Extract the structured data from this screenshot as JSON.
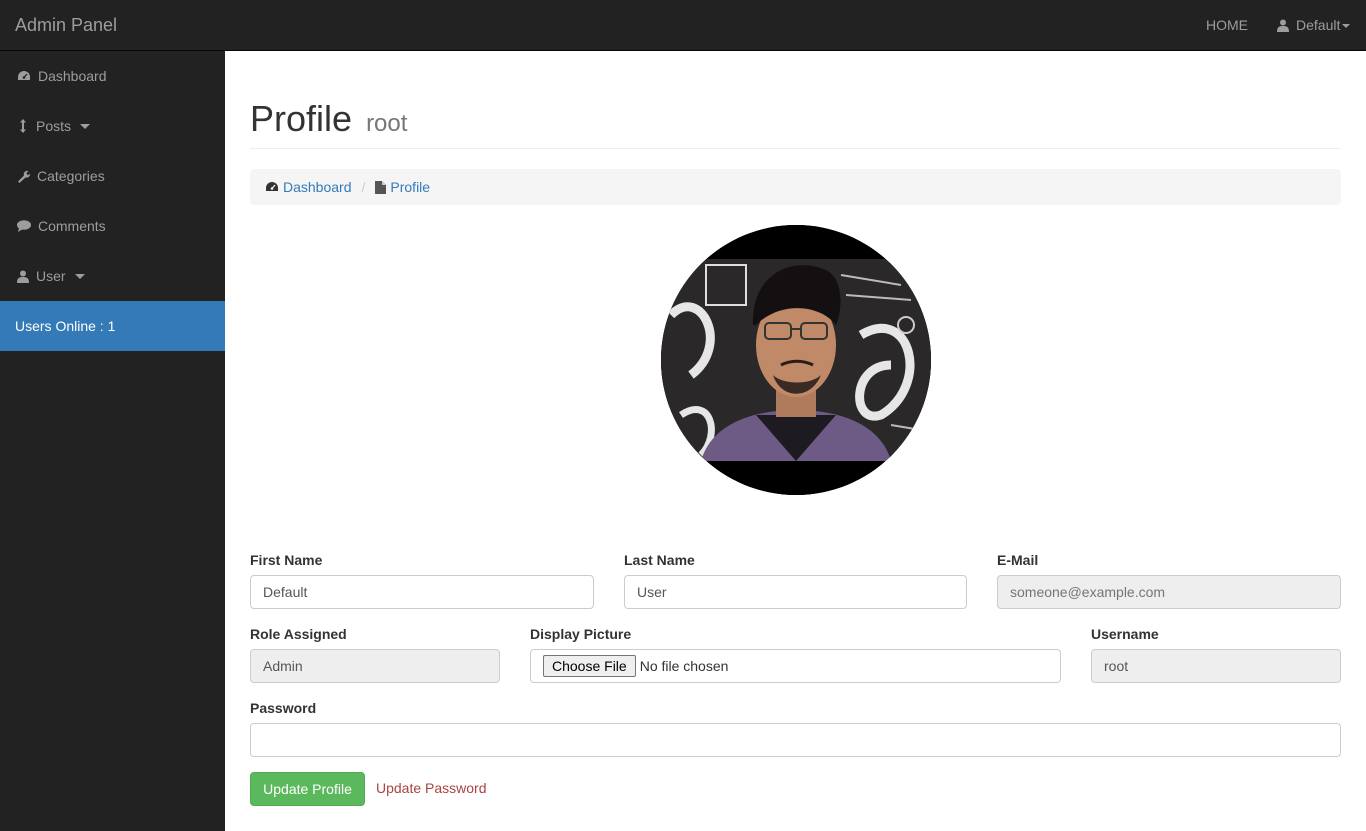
{
  "navbar": {
    "brand": "Admin Panel",
    "home": "HOME",
    "user": "Default"
  },
  "sidebar": {
    "items": [
      {
        "label": "Dashboard",
        "icon": "dashboard-icon"
      },
      {
        "label": "Posts",
        "icon": "arrows-v-icon",
        "has_caret": true
      },
      {
        "label": "Categories",
        "icon": "wrench-icon"
      },
      {
        "label": "Comments",
        "icon": "comment-icon"
      },
      {
        "label": "User",
        "icon": "user-icon",
        "has_caret": true
      }
    ],
    "online": "Users Online : 1",
    "online_color": "#337ab7"
  },
  "page": {
    "title": "Profile",
    "subtitle": "root"
  },
  "breadcrumb": {
    "items": [
      "Dashboard",
      "Profile"
    ]
  },
  "form": {
    "first_name": {
      "label": "First Name",
      "value": "Default"
    },
    "last_name": {
      "label": "Last Name",
      "value": "User"
    },
    "email": {
      "label": "E-Mail",
      "placeholder": "someone@example.com"
    },
    "role": {
      "label": "Role Assigned",
      "value": "Admin"
    },
    "picture": {
      "label": "Display Picture",
      "button": "Choose File",
      "status": "No file chosen"
    },
    "username": {
      "label": "Username",
      "value": "root"
    },
    "password": {
      "label": "Password",
      "value": ""
    },
    "submit": "Update Profile",
    "update_password": "Update Password"
  },
  "colors": {
    "navbar_bg": "#222222",
    "submit_green": "#5cb85c",
    "link_red": "#a94442",
    "link_blue": "#337ab7"
  }
}
